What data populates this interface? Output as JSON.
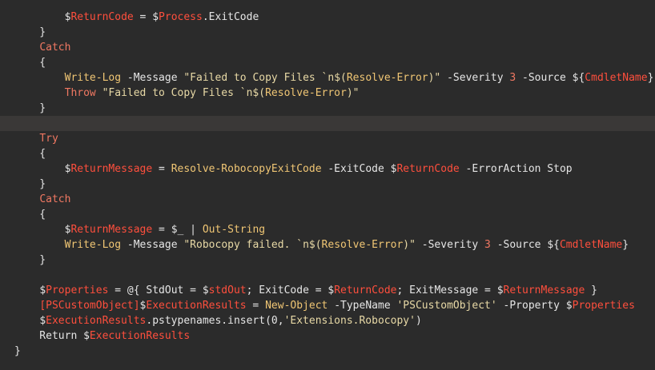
{
  "editor": {
    "lines": [
      {
        "tokens": [
          {
            "t": "        "
          },
          {
            "t": "$",
            "c": "dollar"
          },
          {
            "t": "ReturnCode",
            "c": "var"
          },
          {
            "t": " = "
          },
          {
            "t": "$",
            "c": "dollar"
          },
          {
            "t": "Process",
            "c": "var"
          },
          {
            "t": ".ExitCode"
          }
        ]
      },
      {
        "tokens": [
          {
            "t": "    }"
          }
        ]
      },
      {
        "tokens": [
          {
            "t": "    "
          },
          {
            "t": "Catch",
            "c": "kw"
          }
        ]
      },
      {
        "tokens": [
          {
            "t": "    {"
          }
        ]
      },
      {
        "tokens": [
          {
            "t": "        "
          },
          {
            "t": "Write-Log",
            "c": "cmd"
          },
          {
            "t": " -Message ",
            "c": "param"
          },
          {
            "t": "\"Failed to Copy Files `n$(",
            "c": "str"
          },
          {
            "t": "Resolve-Error",
            "c": "cmd"
          },
          {
            "t": ")\"",
            "c": "str"
          },
          {
            "t": " -Severity ",
            "c": "param"
          },
          {
            "t": "3",
            "c": "num"
          },
          {
            "t": " -Source ",
            "c": "param"
          },
          {
            "t": "${",
            "c": "plain"
          },
          {
            "t": "CmdletName",
            "c": "var"
          },
          {
            "t": "}",
            "c": "plain"
          }
        ]
      },
      {
        "tokens": [
          {
            "t": "        "
          },
          {
            "t": "Throw",
            "c": "kw"
          },
          {
            "t": " \"Failed to Copy Files `n$(",
            "c": "str"
          },
          {
            "t": "Resolve-Error",
            "c": "cmd"
          },
          {
            "t": ")\"",
            "c": "str"
          }
        ]
      },
      {
        "tokens": [
          {
            "t": "    }"
          }
        ]
      },
      {
        "tokens": [
          {
            "t": ""
          }
        ],
        "current": true
      },
      {
        "tokens": [
          {
            "t": "    "
          },
          {
            "t": "Try",
            "c": "kw"
          }
        ]
      },
      {
        "tokens": [
          {
            "t": "    {"
          }
        ]
      },
      {
        "tokens": [
          {
            "t": "        "
          },
          {
            "t": "$",
            "c": "dollar"
          },
          {
            "t": "ReturnMessage",
            "c": "var"
          },
          {
            "t": " = "
          },
          {
            "t": "Resolve-RobocopyExitCode",
            "c": "cmd"
          },
          {
            "t": " -ExitCode ",
            "c": "param"
          },
          {
            "t": "$",
            "c": "dollar"
          },
          {
            "t": "ReturnCode",
            "c": "var"
          },
          {
            "t": " -ErrorAction Stop",
            "c": "param"
          }
        ]
      },
      {
        "tokens": [
          {
            "t": "    }"
          }
        ]
      },
      {
        "tokens": [
          {
            "t": "    "
          },
          {
            "t": "Catch",
            "c": "kw"
          }
        ]
      },
      {
        "tokens": [
          {
            "t": "    {"
          }
        ]
      },
      {
        "tokens": [
          {
            "t": "        "
          },
          {
            "t": "$",
            "c": "dollar"
          },
          {
            "t": "ReturnMessage",
            "c": "var"
          },
          {
            "t": " = "
          },
          {
            "t": "$_",
            "c": "dollar"
          },
          {
            "t": " | "
          },
          {
            "t": "Out-String",
            "c": "cmd"
          }
        ]
      },
      {
        "tokens": [
          {
            "t": "        "
          },
          {
            "t": "Write-Log",
            "c": "cmd"
          },
          {
            "t": " -Message ",
            "c": "param"
          },
          {
            "t": "\"Robocopy failed. `n$(",
            "c": "str"
          },
          {
            "t": "Resolve-Error",
            "c": "cmd"
          },
          {
            "t": ")\"",
            "c": "str"
          },
          {
            "t": " -Severity ",
            "c": "param"
          },
          {
            "t": "3",
            "c": "num"
          },
          {
            "t": " -Source ",
            "c": "param"
          },
          {
            "t": "${",
            "c": "plain"
          },
          {
            "t": "CmdletName",
            "c": "var"
          },
          {
            "t": "}",
            "c": "plain"
          }
        ]
      },
      {
        "tokens": [
          {
            "t": "    }"
          }
        ]
      },
      {
        "tokens": [
          {
            "t": ""
          }
        ]
      },
      {
        "tokens": [
          {
            "t": "    "
          },
          {
            "t": "$",
            "c": "dollar"
          },
          {
            "t": "Properties",
            "c": "var"
          },
          {
            "t": " = @{ StdOut = "
          },
          {
            "t": "$",
            "c": "dollar"
          },
          {
            "t": "stdOut",
            "c": "var"
          },
          {
            "t": "; ExitCode = "
          },
          {
            "t": "$",
            "c": "dollar"
          },
          {
            "t": "ReturnCode",
            "c": "var"
          },
          {
            "t": "; ExitMessage = "
          },
          {
            "t": "$",
            "c": "dollar"
          },
          {
            "t": "ReturnMessage",
            "c": "var"
          },
          {
            "t": " }"
          }
        ]
      },
      {
        "tokens": [
          {
            "t": "    "
          },
          {
            "t": "[PSCustomObject]",
            "c": "type"
          },
          {
            "t": "$",
            "c": "dollar"
          },
          {
            "t": "ExecutionResults",
            "c": "var"
          },
          {
            "t": " = "
          },
          {
            "t": "New-Object",
            "c": "cmd"
          },
          {
            "t": " -TypeName ",
            "c": "param"
          },
          {
            "t": "'PSCustomObject'",
            "c": "str"
          },
          {
            "t": " -Property ",
            "c": "param"
          },
          {
            "t": "$",
            "c": "dollar"
          },
          {
            "t": "Properties",
            "c": "var"
          }
        ]
      },
      {
        "tokens": [
          {
            "t": "    "
          },
          {
            "t": "$",
            "c": "dollar"
          },
          {
            "t": "ExecutionResults",
            "c": "var"
          },
          {
            "t": ".pstypenames.insert(0,"
          },
          {
            "t": "'Extensions.Robocopy'",
            "c": "str"
          },
          {
            "t": ")"
          }
        ]
      },
      {
        "tokens": [
          {
            "t": "    Return "
          },
          {
            "t": "$",
            "c": "dollar"
          },
          {
            "t": "ExecutionResults",
            "c": "var"
          }
        ]
      },
      {
        "tokens": [
          {
            "t": "}"
          }
        ]
      }
    ]
  }
}
